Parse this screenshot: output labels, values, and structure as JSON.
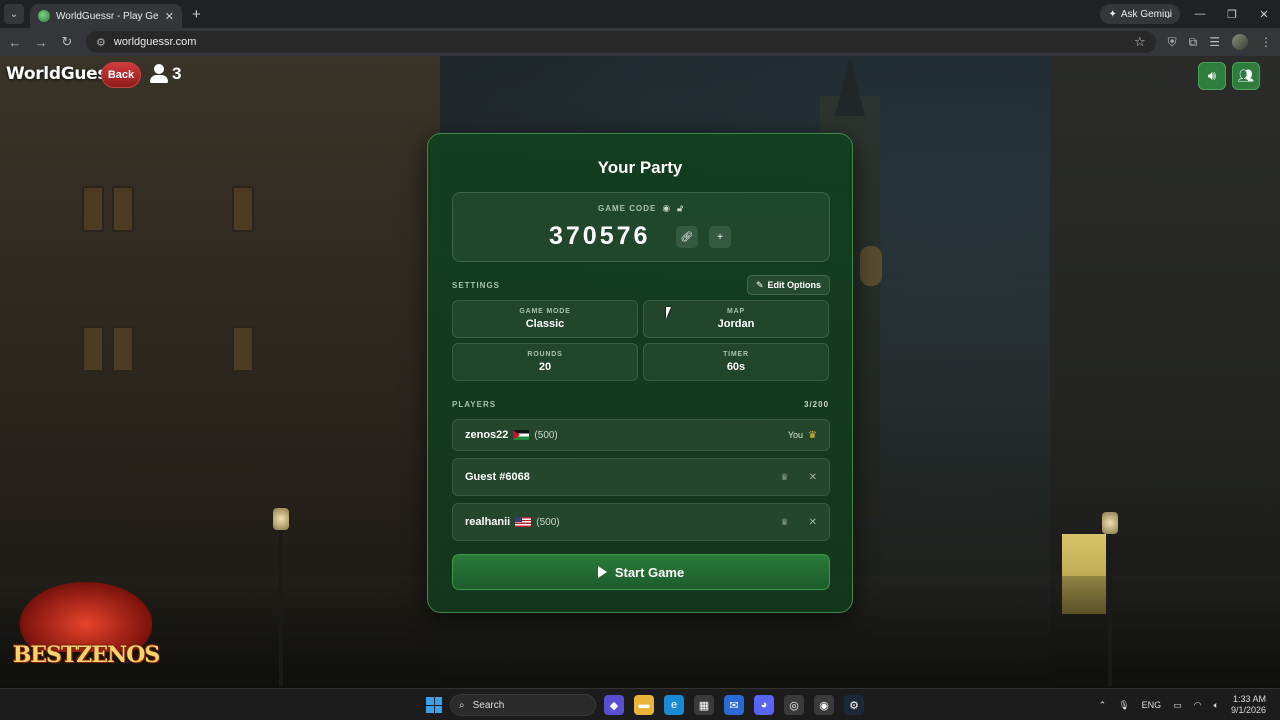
{
  "browser": {
    "tab_title": "WorldGuessr - Play GeoGuessr",
    "ask_gemini": "Ask Gemini",
    "url": "worldguessr.com"
  },
  "app": {
    "brand": "WorldGuessr",
    "back_label": "Back",
    "online_count": "3"
  },
  "party": {
    "title": "Your Party",
    "game_code_label": "GAME CODE",
    "game_code": "370576",
    "settings_label": "SETTINGS",
    "edit_options_label": "Edit Options",
    "settings": [
      {
        "label": "GAME MODE",
        "value": "Classic"
      },
      {
        "label": "MAP",
        "value": "Jordan"
      },
      {
        "label": "ROUNDS",
        "value": "20"
      },
      {
        "label": "TIMER",
        "value": "60s"
      }
    ],
    "players_label": "PLAYERS",
    "players_count": "3/200",
    "players": [
      {
        "name": "zenos22",
        "elo": "(500)",
        "tag": "You"
      },
      {
        "name": "Guest #6068"
      },
      {
        "name": "realhanii",
        "elo": "(500)"
      }
    ],
    "start_label": "Start Game"
  },
  "overlay": {
    "logo_text": "BESTZENOS"
  },
  "taskbar": {
    "search_placeholder": "Search",
    "lang": "ENG",
    "time": "1:33 AM",
    "date": "9/1/2026"
  },
  "colors": {
    "panel_bg": "#143d1d",
    "accent_green": "#2a7a3b",
    "back_red": "#c33030"
  }
}
